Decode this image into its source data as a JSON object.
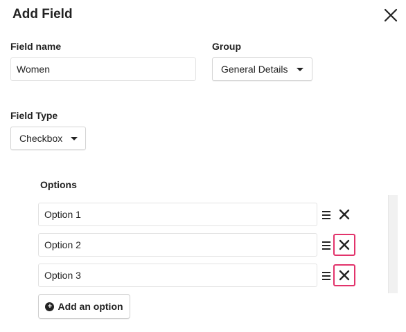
{
  "dialog": {
    "title": "Add Field",
    "close_icon": "close-icon"
  },
  "field_name": {
    "label": "Field name",
    "value": "Women"
  },
  "group": {
    "label": "Group",
    "selected": "General Details"
  },
  "field_type": {
    "label": "Field Type",
    "selected": "Checkbox"
  },
  "options": {
    "label": "Options",
    "items": [
      {
        "value": "Option 1",
        "delete_highlighted": false
      },
      {
        "value": "Option 2",
        "delete_highlighted": true
      },
      {
        "value": "Option 3",
        "delete_highlighted": true
      }
    ],
    "add_label": "Add an option"
  },
  "colors": {
    "highlight": "#e2336b",
    "text": "#222222",
    "border": "#e2e2e2"
  }
}
